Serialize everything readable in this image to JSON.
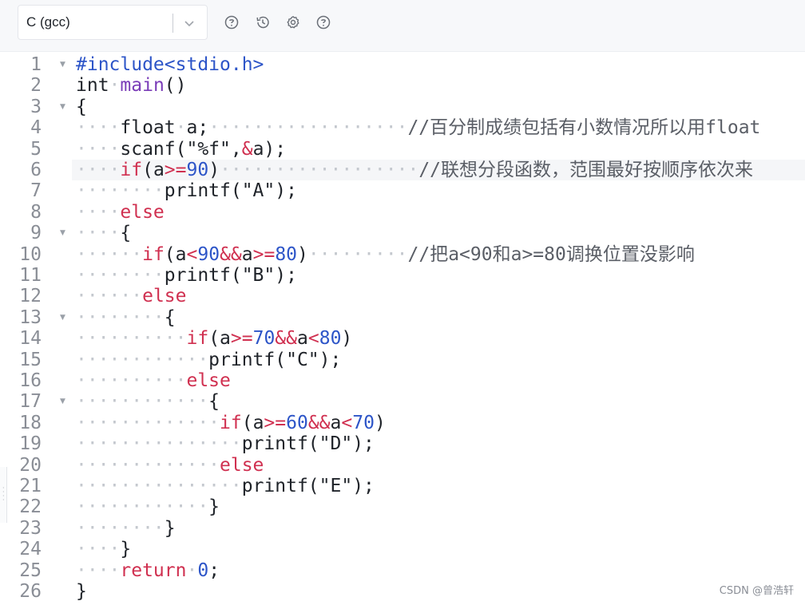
{
  "toolbar": {
    "language": "C (gcc)",
    "icons": [
      "help-icon",
      "history-icon",
      "settings-icon",
      "question-icon"
    ]
  },
  "colors": {
    "keyword": "#d03050",
    "preprocessor": "#2d55c8",
    "number": "#2d55c8",
    "function": "#7a3cb8",
    "whitespace_dots": "#c4c8ce",
    "line_number": "#8a8e96"
  },
  "editor": {
    "active_line": 6,
    "lines": [
      {
        "n": "1",
        "fold": true,
        "html": "<span class=\"pre\">#include&lt;stdio.h&gt;</span>"
      },
      {
        "n": "2",
        "fold": false,
        "html": "int<span class=\"ws\">·</span><span class=\"fn\">main</span>()"
      },
      {
        "n": "3",
        "fold": true,
        "html": "{"
      },
      {
        "n": "4",
        "fold": false,
        "html": "<span class=\"ws\">····</span>float<span class=\"ws\">·</span>a;<span class=\"ws\">··················</span><span class=\"cmt\">//百分制成绩包括有小数情况所以用float</span>"
      },
      {
        "n": "5",
        "fold": false,
        "html": "<span class=\"ws\">····</span>scanf(\"%f\",<span class=\"kw\">&amp;</span>a);"
      },
      {
        "n": "6",
        "fold": false,
        "html": "<span class=\"ws\">····</span><span class=\"kw\">if</span>(a<span class=\"kw\">&gt;=</span><span class=\"num\">90</span>)<span class=\"ws\">··················</span><span class=\"cmt\">//联想分段函数，范围最好按顺序依次来</span>"
      },
      {
        "n": "7",
        "fold": false,
        "html": "<span class=\"ws\">········</span>printf(\"A\");"
      },
      {
        "n": "8",
        "fold": false,
        "html": "<span class=\"ws\">····</span><span class=\"kw\">else</span>"
      },
      {
        "n": "9",
        "fold": true,
        "html": "<span class=\"ws\">····</span>{"
      },
      {
        "n": "10",
        "fold": false,
        "html": "<span class=\"ws\">······</span><span class=\"kw\">if</span>(a<span class=\"kw\">&lt;</span><span class=\"num\">90</span><span class=\"kw\">&amp;&amp;</span>a<span class=\"kw\">&gt;=</span><span class=\"num\">80</span>)<span class=\"ws\">·········</span><span class=\"cmt\">//把a&lt;90和a&gt;=80调换位置没影响</span>"
      },
      {
        "n": "11",
        "fold": false,
        "html": "<span class=\"ws\">········</span>printf(\"B\");"
      },
      {
        "n": "12",
        "fold": false,
        "html": "<span class=\"ws\">······</span><span class=\"kw\">else</span>"
      },
      {
        "n": "13",
        "fold": true,
        "html": "<span class=\"ws\">········</span>{"
      },
      {
        "n": "14",
        "fold": false,
        "html": "<span class=\"ws\">··········</span><span class=\"kw\">if</span>(a<span class=\"kw\">&gt;=</span><span class=\"num\">70</span><span class=\"kw\">&amp;&amp;</span>a<span class=\"kw\">&lt;</span><span class=\"num\">80</span>)"
      },
      {
        "n": "15",
        "fold": false,
        "html": "<span class=\"ws\">············</span>printf(\"C\");"
      },
      {
        "n": "16",
        "fold": false,
        "html": "<span class=\"ws\">··········</span><span class=\"kw\">else</span>"
      },
      {
        "n": "17",
        "fold": true,
        "html": "<span class=\"ws\">············</span>{"
      },
      {
        "n": "18",
        "fold": false,
        "html": "<span class=\"ws\">·············</span><span class=\"kw\">if</span>(a<span class=\"kw\">&gt;=</span><span class=\"num\">60</span><span class=\"kw\">&amp;&amp;</span>a<span class=\"kw\">&lt;</span><span class=\"num\">70</span>)"
      },
      {
        "n": "19",
        "fold": false,
        "html": "<span class=\"ws\">···············</span>printf(\"D\");"
      },
      {
        "n": "20",
        "fold": false,
        "html": "<span class=\"ws\">·············</span><span class=\"kw\">else</span>"
      },
      {
        "n": "21",
        "fold": false,
        "html": "<span class=\"ws\">···············</span>printf(\"E\");"
      },
      {
        "n": "22",
        "fold": false,
        "html": "<span class=\"ws\">············</span>}"
      },
      {
        "n": "23",
        "fold": false,
        "html": "<span class=\"ws\">········</span>}"
      },
      {
        "n": "24",
        "fold": false,
        "html": "<span class=\"ws\">····</span>}"
      },
      {
        "n": "25",
        "fold": false,
        "html": "<span class=\"ws\">····</span><span class=\"kw\">return</span><span class=\"ws\">·</span><span class=\"num\">0</span>;"
      },
      {
        "n": "26",
        "fold": false,
        "html": "}"
      }
    ]
  },
  "watermark": "CSDN @曾浩轩"
}
